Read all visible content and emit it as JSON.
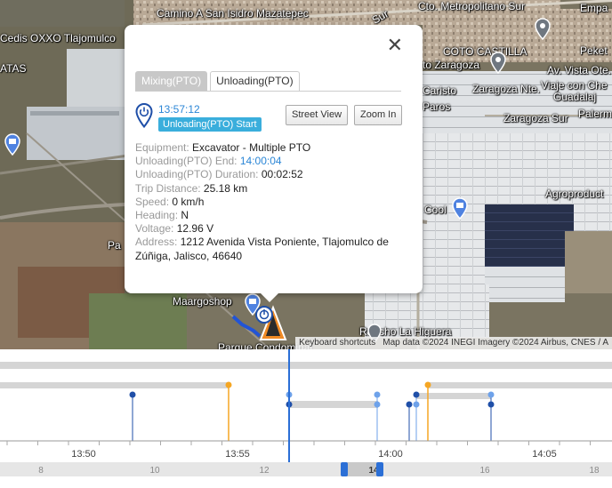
{
  "map": {
    "labels": {
      "camino": "Camino A San Isidro Mazatepec",
      "cto": "Cto. Metropolitano Sur",
      "emp": "Empa",
      "cedis": "Cedis OXXO Tlajomulco",
      "coto": "COTO CASTILLA",
      "atas": "ATAS",
      "zaragoza": "to Zaragoza",
      "peket": "Peket",
      "vista": "Av. Vista Ote.",
      "viaje": "Viaje con Che",
      "guadal": "Guadalaj",
      "caristo": "Caristo",
      "zaragoza_nte": "Zaragoza Nte.",
      "paros": "Paros",
      "zaragoza_sur": "Zaragoza Sur",
      "palerm": "Palerm",
      "agro": "Agroproduct",
      "cool": "Cool",
      "pa": "Pa",
      "maargoshop": "Maargoshop",
      "rancho": "Rancho La Higuera",
      "parque": "Parque Condominal",
      "sur": "Sur"
    },
    "attribution": {
      "shortcuts": "Keyboard shortcuts",
      "data": "Map data ©2024 INEGI Imagery ©2024 Airbus, CNES / A"
    }
  },
  "popup": {
    "close_glyph": "✕",
    "tabs": [
      "Mixing(PTO)",
      "Unloading(PTO)"
    ],
    "event_time": "13:57:12",
    "event_label": "Unloading(PTO) Start",
    "street_view_label": "Street View",
    "zoom_in_label": "Zoom In",
    "details": [
      {
        "label": "Equipment:",
        "value": "Excavator - Multiple PTO"
      },
      {
        "label": "Unloading(PTO) End:",
        "value": "14:00:04"
      },
      {
        "label": "Unloading(PTO) Duration:",
        "value": "00:02:52"
      },
      {
        "label": "Trip Distance:",
        "value": "25.18 km"
      },
      {
        "label": "Speed:",
        "value": "0 km/h"
      },
      {
        "label": "Heading:",
        "value": "N"
      },
      {
        "label": "Voltage:",
        "value": "12.96 V"
      },
      {
        "label": "Address:",
        "value": "1212 Avenida Vista Poniente, Tlajomulco de Zúñiga, Jalisco, 46640"
      }
    ],
    "icons": {
      "event": "power-pin-icon",
      "close": "close-icon"
    }
  },
  "timeline": {
    "time_ticks": [
      "13:50",
      "13:55",
      "14:00",
      "14:05"
    ],
    "scroll_ticks": [
      "8",
      "10",
      "12",
      "14",
      "16",
      "18"
    ],
    "colors": {
      "dark_blue": "#1f4fa8",
      "light_blue": "#6ea2ea",
      "orange": "#f5a623",
      "cursor": "#2b6fd6"
    }
  }
}
